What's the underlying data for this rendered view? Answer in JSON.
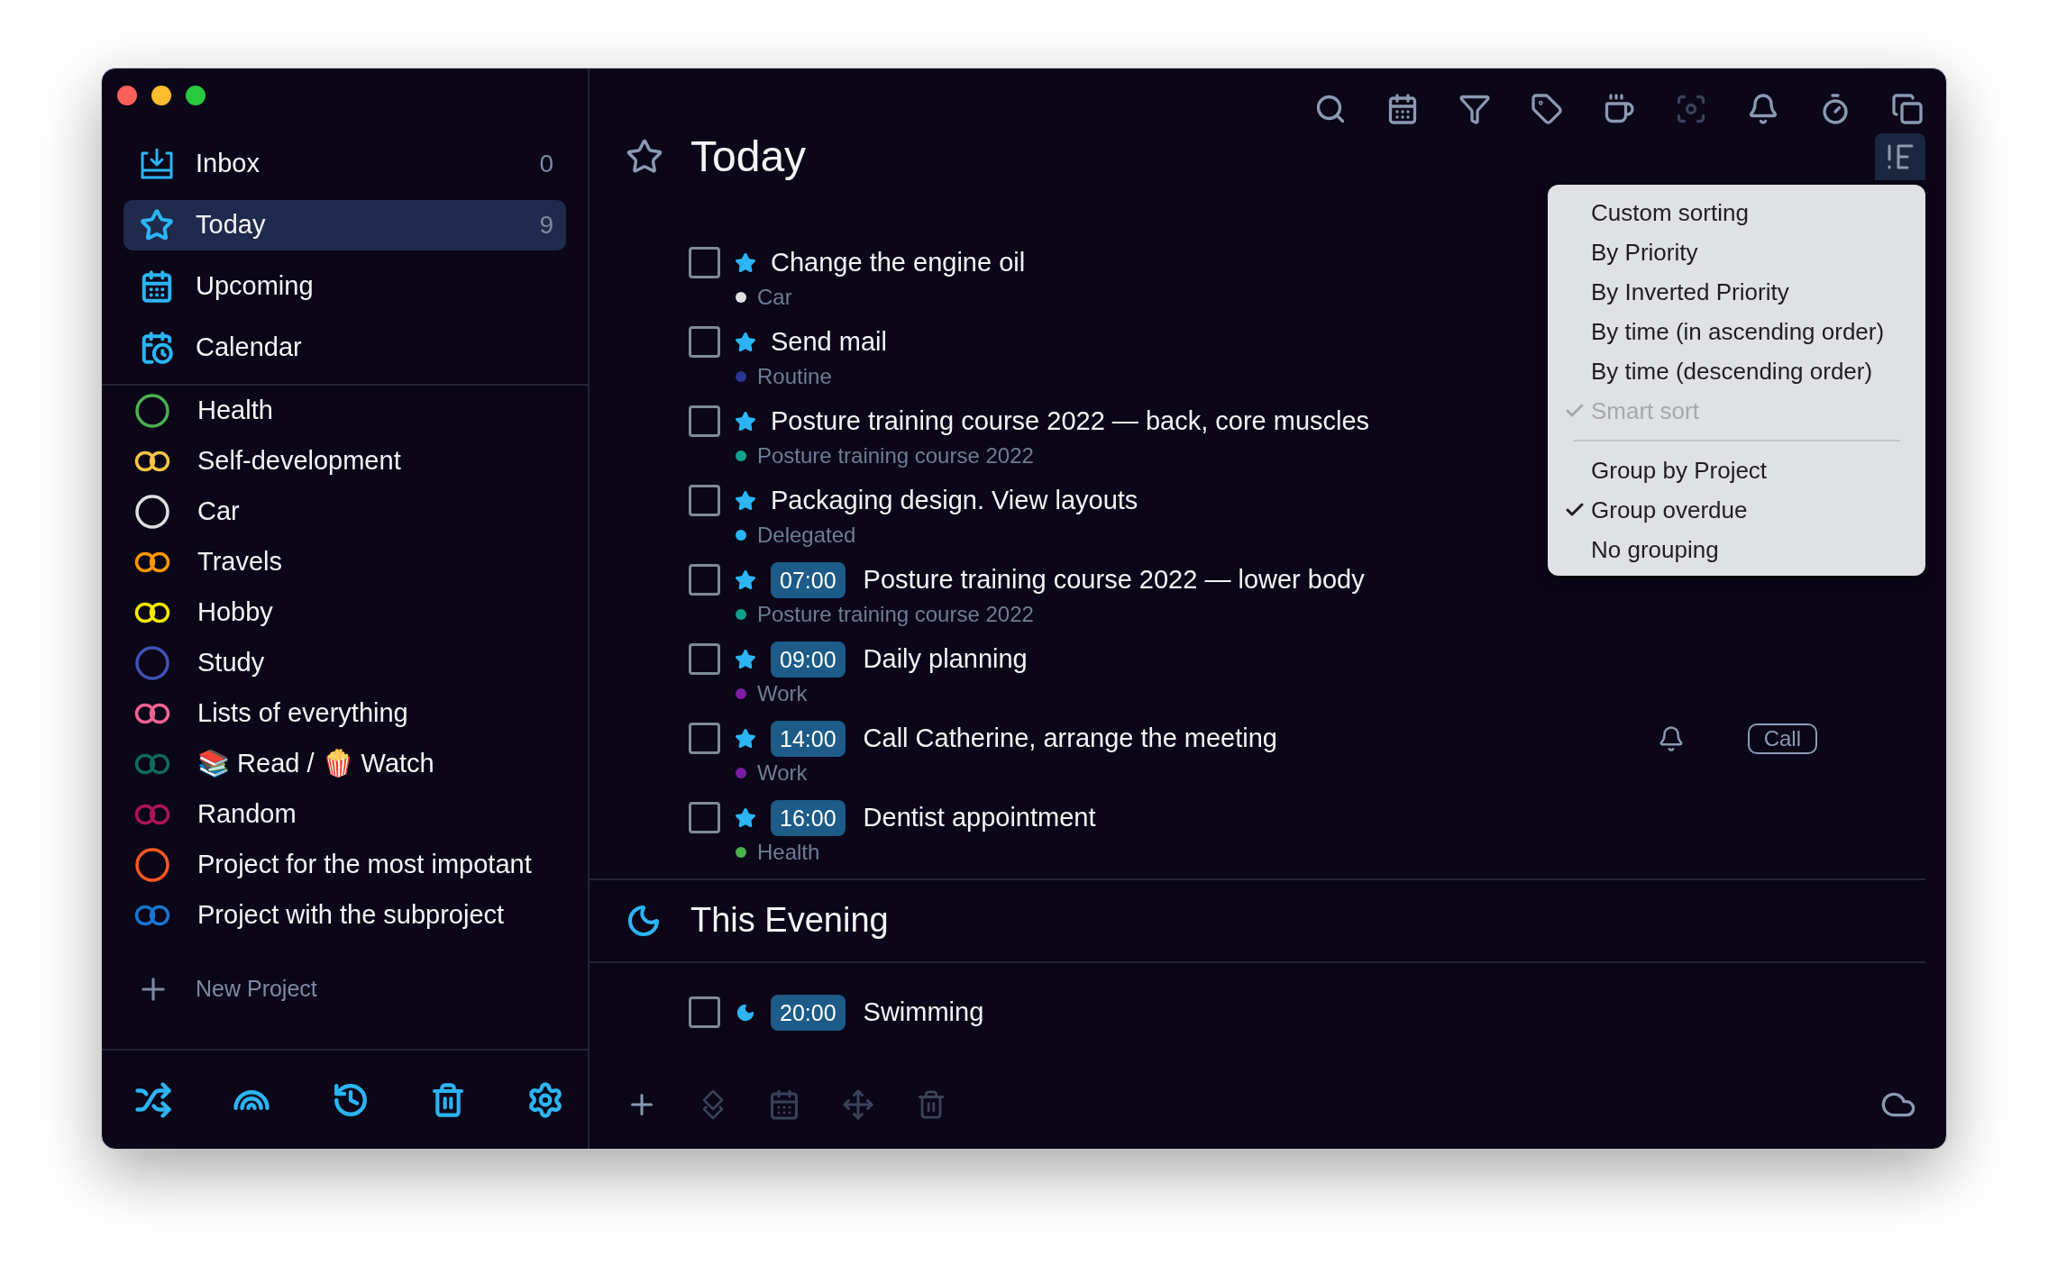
{
  "sidebar": {
    "nav": [
      {
        "label": "Inbox",
        "count": "0",
        "selected": false
      },
      {
        "label": "Today",
        "count": "9",
        "selected": true
      },
      {
        "label": "Upcoming",
        "selected": false
      },
      {
        "label": "Calendar",
        "selected": false
      }
    ],
    "projects": [
      {
        "name": "Health",
        "color": "#4caf50",
        "kind": "single"
      },
      {
        "name": "Self-development",
        "color": "#f5c542",
        "kind": "double"
      },
      {
        "name": "Car",
        "color": "#e0e0e0",
        "kind": "single"
      },
      {
        "name": "Travels",
        "color": "#ff9800",
        "kind": "double"
      },
      {
        "name": "Hobby",
        "color": "#f5ea00",
        "kind": "double"
      },
      {
        "name": "Study",
        "color": "#3f51b5",
        "kind": "single"
      },
      {
        "name": "Lists of everything",
        "color": "#f06292",
        "kind": "double"
      },
      {
        "name": "📚 Read / 🍿 Watch",
        "color": "#0e6b5e",
        "kind": "double"
      },
      {
        "name": "Random",
        "color": "#ad1457",
        "kind": "double"
      },
      {
        "name": "Project for the most impotant",
        "color": "#ff5722",
        "kind": "single"
      },
      {
        "name": "Project with the subproject",
        "color": "#1976d2",
        "kind": "double"
      }
    ],
    "new_project": "New Project"
  },
  "toolbar": [
    {
      "disabled": false
    },
    {
      "disabled": false
    },
    {
      "disabled": false
    },
    {
      "disabled": false
    },
    {
      "disabled": false
    },
    {
      "disabled": true
    },
    {
      "disabled": false
    },
    {
      "disabled": false
    },
    {
      "disabled": false
    }
  ],
  "header": {
    "title": "Today",
    "sort_button": {
      "expanded": true
    }
  },
  "sort_menu": {
    "groups": [
      [
        {
          "label": "Custom sorting",
          "checked": false,
          "disabled": false
        },
        {
          "label": "By Priority",
          "checked": false,
          "disabled": false
        },
        {
          "label": "By Inverted Priority",
          "checked": false,
          "disabled": false
        },
        {
          "label": "By time (in ascending order)",
          "checked": false,
          "disabled": false
        },
        {
          "label": "By time (descending order)",
          "checked": false,
          "disabled": false
        },
        {
          "label": "Smart sort",
          "checked": true,
          "disabled": true
        }
      ],
      [
        {
          "label": "Group by Project",
          "checked": false,
          "disabled": false
        },
        {
          "label": "Group overdue",
          "checked": true,
          "disabled": false
        },
        {
          "label": "No grouping",
          "checked": false,
          "disabled": false
        }
      ]
    ]
  },
  "tasks": [
    {
      "title": "Change the engine oil",
      "project": "Car",
      "color": "#e0e0e0",
      "kind": "star",
      "checked": false,
      "reminder": false
    },
    {
      "title": "Send mail",
      "project": "Routine",
      "color": "#283593",
      "kind": "star",
      "checked": false,
      "reminder": false
    },
    {
      "title": "Posture training course 2022 — back, core muscles",
      "project": "Posture training course 2022",
      "color": "#11a08a",
      "kind": "star",
      "checked": false,
      "reminder": false
    },
    {
      "title": "Packaging design. View layouts",
      "project": "Delegated",
      "color": "#29b6f6",
      "kind": "star",
      "checked": false,
      "reminder": false
    },
    {
      "time": "07:00",
      "title": "Posture training course 2022 — lower body",
      "project": "Posture training course 2022",
      "color": "#11a08a",
      "kind": "star",
      "checked": false,
      "reminder": false
    },
    {
      "time": "09:00",
      "title": "Daily planning",
      "project": "Work",
      "color": "#7b1fa2",
      "kind": "star",
      "checked": false,
      "reminder": false
    },
    {
      "time": "14:00",
      "title": "Call Catherine, arrange the meeting",
      "project": "Work",
      "color": "#7b1fa2",
      "kind": "star",
      "checked": false,
      "reminder": true,
      "tag": "Call"
    },
    {
      "time": "16:00",
      "title": "Dentist appointment",
      "project": "Health",
      "color": "#4caf50",
      "kind": "star",
      "checked": false,
      "reminder": false
    }
  ],
  "evening": {
    "title": "This Evening",
    "tasks": [
      {
        "time": "20:00",
        "title": "Swimming",
        "kind": "moon",
        "checked": false,
        "reminder": false
      }
    ]
  },
  "bottom_toolbar": [
    {
      "disabled": false
    },
    {
      "disabled": true
    },
    {
      "disabled": true
    },
    {
      "disabled": true
    },
    {
      "disabled": true
    }
  ]
}
